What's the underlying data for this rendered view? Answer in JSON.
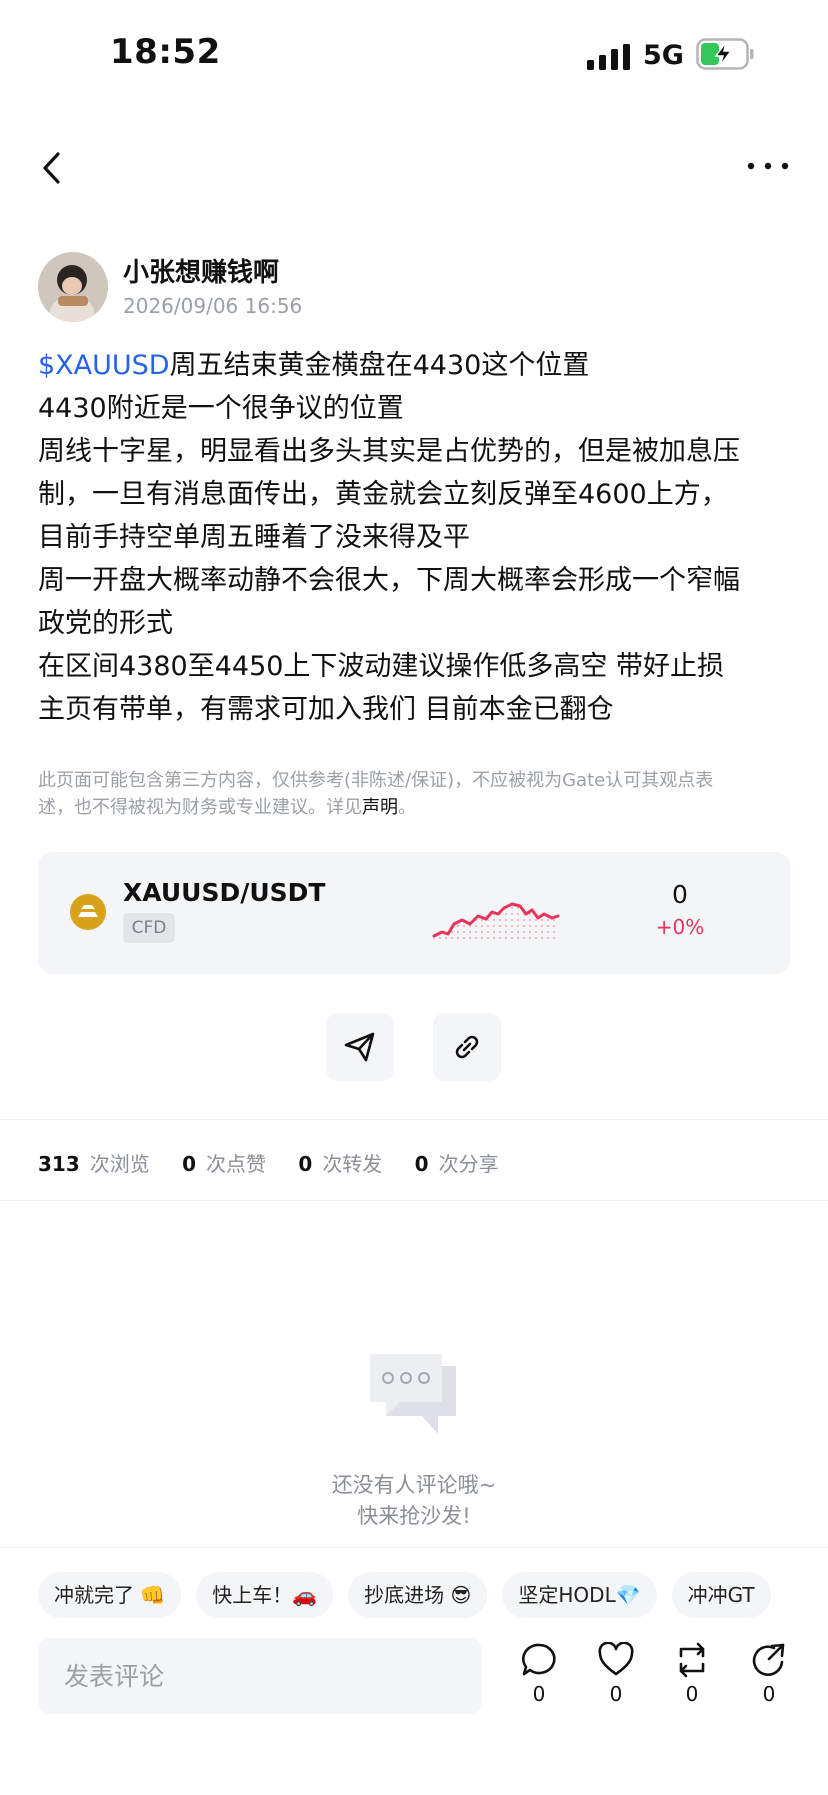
{
  "status_bar": {
    "time": "18:52",
    "network": "5G"
  },
  "nav": {
    "back_icon": "chevron-left-icon",
    "more_icon": "more-horizontal-icon"
  },
  "author": {
    "name": "小张想赚钱啊",
    "time": "2026/09/06 16:56"
  },
  "post": {
    "ticker": "$XAUUSD",
    "first_line_rest": "周五结束黄金横盘在4430这个位置",
    "lines": [
      "4430附近是一个很争议的位置",
      "周线十字星，明显看出多头其实是占优势的，但是被加息压",
      "制，一旦有消息面传出，黄金就会立刻反弹至4600上方，",
      "目前手持空单周五睡着了没来得及平",
      "周一开盘大概率动静不会很大，下周大概率会形成一个窄幅",
      "政党的形式",
      "在区间4380至4450上下波动建议操作低多高空 带好止损",
      "主页有带单，有需求可加入我们 目前本金已翻仓"
    ]
  },
  "disclaimer": {
    "line1": "此页面可能包含第三方内容，仅供参考(非陈述/保证)，不应被视为Gate认可其观点表",
    "line2": "述，也不得被视为财务或专业建议。详见",
    "link": "声明",
    "end": "。"
  },
  "market_card": {
    "pair": "XAUUSD/USDT",
    "tag": "CFD",
    "price": "0",
    "change": "+0%",
    "accent_color": "#e8345a",
    "icon_color": "#d9a21b"
  },
  "actions": {
    "share_icon": "send-icon",
    "link_icon": "link-icon"
  },
  "stats": [
    {
      "value": "313",
      "label": "次浏览"
    },
    {
      "value": "0",
      "label": "次点赞"
    },
    {
      "value": "0",
      "label": "次转发"
    },
    {
      "value": "0",
      "label": "次分享"
    }
  ],
  "empty": {
    "line1": "还没有人评论哦~",
    "line2": "快来抢沙发!"
  },
  "quick_replies": [
    "冲就完了 👊",
    "快上车！🚗",
    "抄底进场 😎",
    "坚定HODL💎",
    "冲冲GT"
  ],
  "bottom_bar": {
    "placeholder": "发表评论",
    "comment_count": "0",
    "like_count": "0",
    "repost_count": "0",
    "share_count": "0"
  }
}
